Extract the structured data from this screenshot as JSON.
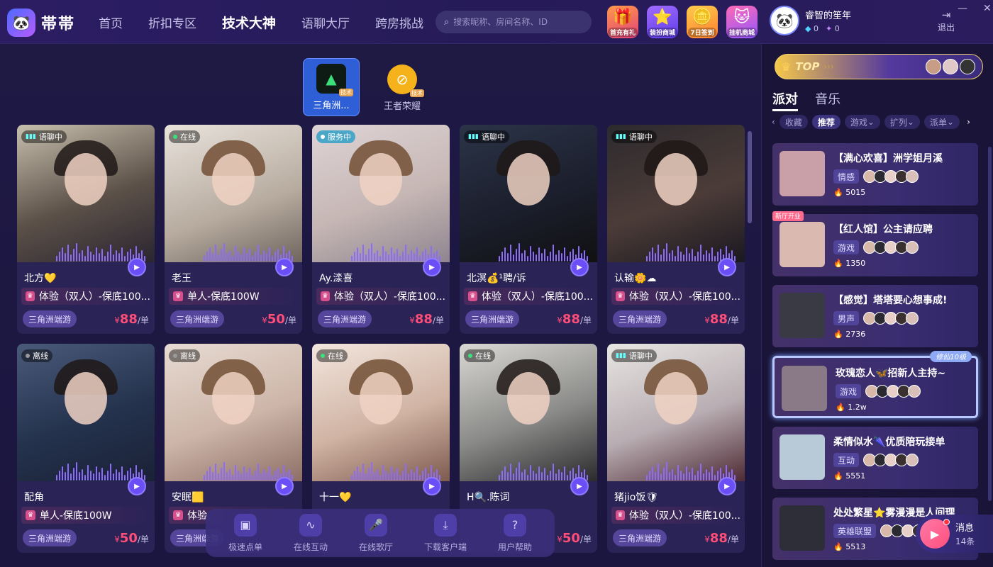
{
  "header": {
    "logo_text": "帯帯",
    "nav": [
      "首页",
      "折扣专区",
      "技术大神",
      "语聊大厅",
      "跨房挑战"
    ],
    "nav_active": 2,
    "search_placeholder": "搜索昵称、房间名称、ID",
    "promos": [
      "首充有礼",
      "装扮商城",
      "7日签到",
      "挂机商城"
    ],
    "user": {
      "name": "睿智的笙年",
      "diamonds": "0",
      "points": "0"
    },
    "logout": "退出"
  },
  "categories": [
    {
      "label": "三角洲...",
      "tag": "技术",
      "active": true
    },
    {
      "label": "王者荣耀",
      "tag": "技术",
      "active": false
    }
  ],
  "cards": [
    {
      "status": "语聊中",
      "name": "北方💛",
      "service": "体验（双人）-保底100...",
      "game": "三角洲端游",
      "price": "88",
      "unit": "/单",
      "icon_currency": "¥"
    },
    {
      "status": "在线",
      "name": "老王",
      "service": "单人-保底100W",
      "game": "三角洲端游",
      "price": "50",
      "unit": "/单",
      "icon_currency": "¥"
    },
    {
      "status": "服务中",
      "name": "Ay.渁喜",
      "service": "体验（双人）-保底100...",
      "game": "三角洲端游",
      "price": "88",
      "unit": "/单",
      "icon_currency": "¥"
    },
    {
      "status": "语聊中",
      "name": "北溟💰¹聘/诉",
      "service": "体验（双人）-保底100...",
      "game": "三角洲端游",
      "price": "88",
      "unit": "/单",
      "icon_currency": "¥"
    },
    {
      "status": "语聊中",
      "name": "认输🌼☁",
      "service": "体验（双人）-保底100...",
      "game": "三角洲端游",
      "price": "88",
      "unit": "/单",
      "icon_currency": "¥"
    },
    {
      "status": "离线",
      "name": "配角",
      "service": "单人-保底100W",
      "game": "三角洲端游",
      "price": "50",
      "unit": "/单",
      "icon_currency": "¥"
    },
    {
      "status": "离线",
      "name": "安眠🟨",
      "service": "体验",
      "game": "三角洲端游",
      "price": "",
      "unit": "",
      "icon_currency": ""
    },
    {
      "status": "在线",
      "name": "十一💛",
      "service": "",
      "game": "",
      "price": "",
      "unit": "",
      "icon_currency": ""
    },
    {
      "status": "在线",
      "name": "H🔍.陈词",
      "service": "",
      "game": "",
      "price": "50",
      "unit": "/单",
      "icon_currency": "¥"
    },
    {
      "status": "语聊中",
      "name": "猪jio饭🛡",
      "service": "体验（双人）-保底100...",
      "game": "三角洲端游",
      "price": "88",
      "unit": "/单",
      "icon_currency": "¥"
    }
  ],
  "toolbar": [
    "极速点单",
    "在线互动",
    "在线歌厅",
    "下载客户端",
    "用户帮助"
  ],
  "right_panel": {
    "top_label": "TOP",
    "tabs": [
      "派对",
      "音乐"
    ],
    "active_tab": 0,
    "filters": [
      "收藏",
      "推荐",
      "游戏",
      "扩列",
      "派单"
    ],
    "active_filter": 1,
    "rooms": [
      {
        "title": "【满心欢喜】洲学姐月溪",
        "tag": "情感",
        "hot": "5015",
        "badge": ""
      },
      {
        "title": "【红人馆】公主请应聘",
        "tag": "游戏",
        "hot": "1350",
        "badge": "新厅开业"
      },
      {
        "title": "【感觉】塔塔要心想事成!",
        "tag": "男声",
        "hot": "2736",
        "badge": ""
      },
      {
        "title": "玫瑰恋人🦋招新人主持~",
        "tag": "游戏",
        "hot": "1.2w",
        "badge": "修仙10级"
      },
      {
        "title": "柔情似水🌂优质陪玩接单",
        "tag": "互动",
        "hot": "5551",
        "badge": ""
      },
      {
        "title": "处处繁星⭐雾漫漫是人间理",
        "tag": "英雄联盟",
        "hot": "5513",
        "badge": ""
      }
    ]
  },
  "message": {
    "label": "消息",
    "count": "14条"
  },
  "colors": {
    "accent": "#6b4ef5",
    "price": "#ff4d7a",
    "bg": "#1c1740"
  }
}
